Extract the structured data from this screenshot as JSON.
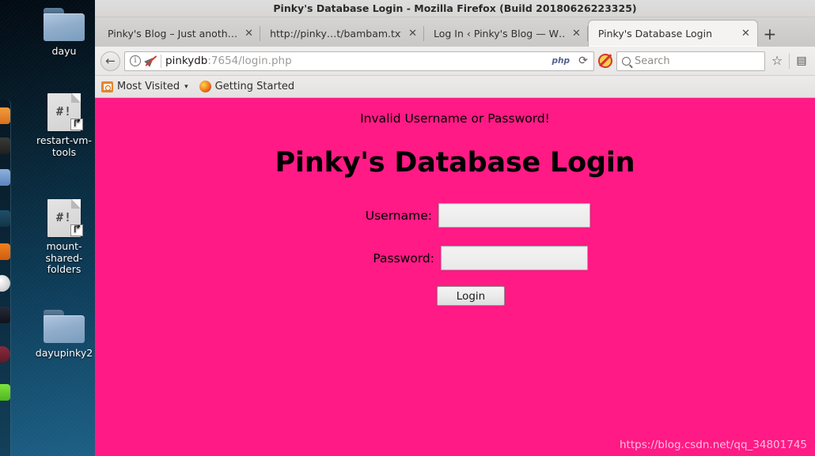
{
  "window": {
    "title": "Pinky's Database Login - Mozilla Firefox (Build 20180626223325)"
  },
  "tabs": [
    {
      "label": "Pinky's Blog – Just anoth…",
      "close": "✕",
      "active": false
    },
    {
      "label": "http://pinky…t/bambam.txt",
      "close": "✕",
      "active": false
    },
    {
      "label": "Log In ‹ Pinky's Blog — W…",
      "close": "✕",
      "active": false
    },
    {
      "label": "Pinky's Database Login",
      "close": "✕",
      "active": true
    }
  ],
  "newtab": {
    "label": "+"
  },
  "toolbar": {
    "back_icon": "←",
    "info_icon": "i",
    "url_host": "pinkydb",
    "url_rest": ":7654/login.php",
    "url_full": "pinkydb:7654/login.php",
    "php_badge": "php",
    "reload_icon": "⟳",
    "noscript_icon": "no-script-icon",
    "search_placeholder": "Search",
    "search_value": "",
    "bookmark_star_icon": "☆",
    "reader_list_icon": "🗒"
  },
  "bookmarks": [
    {
      "label": "Most Visited",
      "icon": "most-visited-folder-icon",
      "chevron": "▾"
    },
    {
      "label": "Getting Started",
      "icon": "firefox-icon",
      "chevron": ""
    }
  ],
  "page": {
    "error_message": "Invalid Username or Password!",
    "heading": "Pinky's Database Login",
    "username_label": "Username:",
    "username_value": "",
    "password_label": "Password:",
    "password_value": "",
    "login_button": "Login",
    "watermark": "https://blog.csdn.net/qq_34801745",
    "background_color": "#ff1a85",
    "text_color": "#000000"
  },
  "desktop": {
    "icons": [
      {
        "label": "dayu",
        "type": "folder"
      },
      {
        "label": "restart-vm-tools",
        "type": "script",
        "glyph": "#!"
      },
      {
        "label": "mount-shared-folders",
        "type": "script",
        "glyph": "#!"
      },
      {
        "label": "dayupinky2",
        "type": "folder"
      }
    ],
    "launcher_colors": [
      "#e8862a",
      "#2b2b2b",
      "#6b93c9",
      "#1b4a63",
      "#e2701b",
      "#e8e8e8",
      "#1a1f2b",
      "#6e2233",
      "#5fd12a"
    ]
  }
}
